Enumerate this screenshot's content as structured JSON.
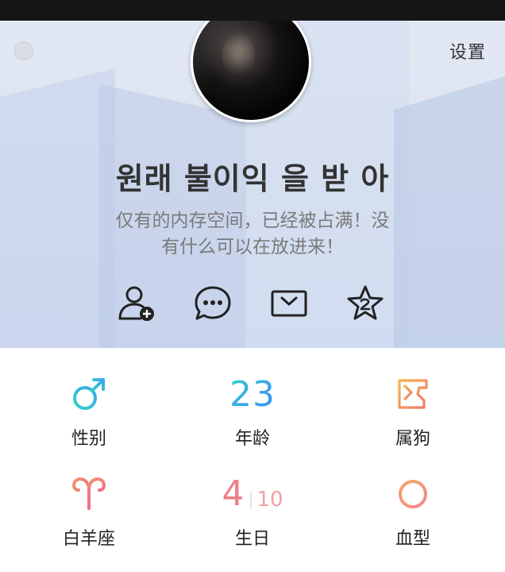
{
  "header": {
    "settings_label": "设置",
    "name": "원래 불이익 을 받 아",
    "signature_line1": "仅有的内存空间，已经被占满！没",
    "signature_line2": "有什么可以在放进来！"
  },
  "actions": [
    {
      "icon": "add-friend-icon"
    },
    {
      "icon": "chat-icon"
    },
    {
      "icon": "mail-icon"
    },
    {
      "icon": "star-icon"
    }
  ],
  "info": {
    "gender": {
      "label": "性别",
      "icon": "male-icon",
      "color": "#3ec6e0"
    },
    "age": {
      "label": "年龄",
      "value": "23"
    },
    "zodiac": {
      "label": "属狗",
      "icon": "dog-zodiac-icon",
      "color": "#f3a04a"
    },
    "constellation": {
      "label": "白羊座",
      "icon": "aries-icon",
      "color": "#f08a7a"
    },
    "birthday": {
      "label": "生日",
      "month": "4",
      "day": "10"
    },
    "blood": {
      "label": "血型",
      "icon": "circle-icon",
      "color": "#f39a88"
    }
  }
}
